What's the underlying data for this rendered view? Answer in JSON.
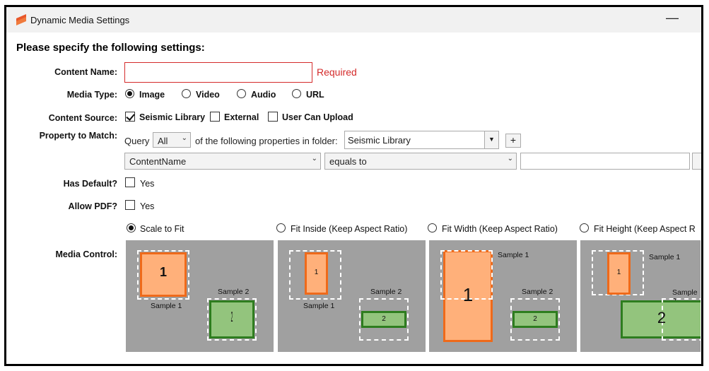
{
  "window": {
    "title": "Dynamic Media Settings",
    "minimize_symbol": "—"
  },
  "heading": "Please specify the following settings:",
  "content_name": {
    "label": "Content Name:",
    "value": "",
    "required_text": "Required"
  },
  "media_type": {
    "label": "Media Type:",
    "options": [
      "Image",
      "Video",
      "Audio",
      "URL"
    ],
    "selected": "Image"
  },
  "content_source": {
    "label": "Content Source:",
    "options": [
      {
        "label": "Seismic Library",
        "checked": true
      },
      {
        "label": "External",
        "checked": false
      },
      {
        "label": "User Can Upload",
        "checked": false
      }
    ]
  },
  "property_match": {
    "label": "Property to Match:",
    "query_label": "Query",
    "query_value": "All",
    "middle_text": "of the following properties in folder:",
    "folder_value": "Seismic Library",
    "add_symbol": "+",
    "property_value": "ContentName",
    "operator_value": "equals to",
    "match_value": ""
  },
  "has_default": {
    "label": "Has Default?",
    "option": "Yes",
    "checked": false
  },
  "allow_pdf": {
    "label": "Allow PDF?",
    "option": "Yes",
    "checked": false
  },
  "media_control": {
    "label": "Media Control:",
    "options": [
      "Scale to Fit",
      "Fit Inside (Keep Aspect Ratio)",
      "Fit Width (Keep Aspect Ratio)",
      "Fit Height (Keep Aspect R"
    ],
    "selected": "Scale to Fit",
    "sample1": "Sample 1",
    "sample2": "Sample 2",
    "n1": "1",
    "n2": "2",
    "n1_dark": "1",
    "n2_glyph": "2"
  },
  "colors": {
    "required": "#d42b2b",
    "orange_fill": "#ffb07a",
    "orange_border": "#ef6a1a",
    "green_fill": "#93c47d",
    "green_border": "#2e7d1f",
    "panel_bg": "#a0a0a0"
  }
}
